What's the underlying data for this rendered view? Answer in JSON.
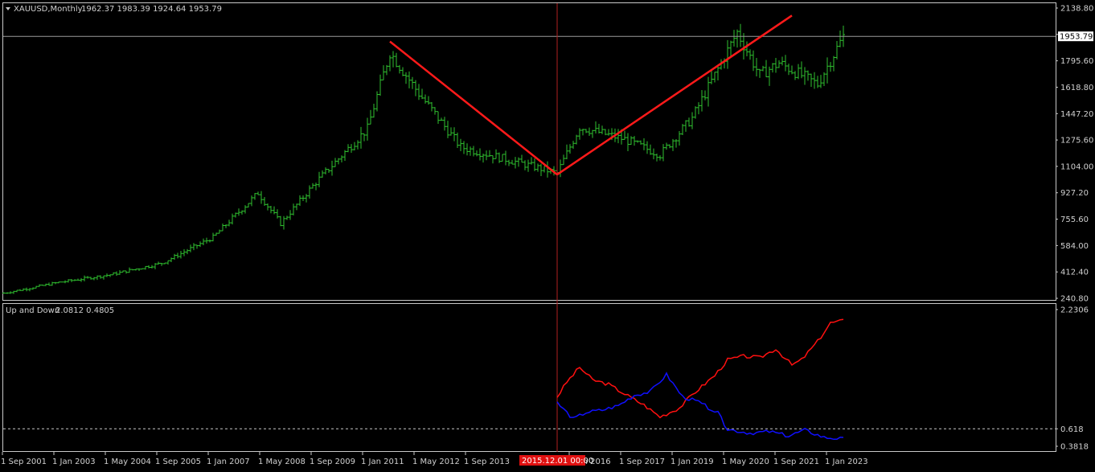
{
  "price_panel": {
    "header": {
      "symbol": "XAUUSD,Monthly",
      "ohlc": "1962.37 1983.39 1924.64 1953.79"
    },
    "y_ticks": [
      "2138.80",
      "1967.20",
      "1795.60",
      "1618.80",
      "1447.20",
      "1275.60",
      "1104.00",
      "927.20",
      "755.60",
      "584.00",
      "412.40",
      "240.80"
    ],
    "last_price_label": "1953.79",
    "colors": {
      "bar": "#2fc02f",
      "trendline": "#ff1a1a",
      "crosshair": "#b02020",
      "grid": "#9a9a9a",
      "label_bg": "#ffffff"
    }
  },
  "indicator_panel": {
    "header": {
      "name": "Up and Down",
      "values": "2.0812 0.4805"
    },
    "y_ticks": [
      "2.2306",
      "0.618",
      "0.3818"
    ],
    "colors": {
      "up_line": "#ff1010",
      "down_line": "#1010ff",
      "level_line": "#c8c8c8"
    }
  },
  "x_axis": {
    "tick_labels": [
      "1 Sep 2001",
      "1 Jan 2003",
      "1 May 2004",
      "1 Sep 2005",
      "1 Jan 2007",
      "1 May 2008",
      "1 Sep 2009",
      "1 Jan 2011",
      "1 May 2012",
      "1 Sep 2013",
      "1 Jan 2016",
      "1 Sep 2017",
      "1 Jan 2019",
      "1 May 2020",
      "1 Sep 2021",
      "1 Jan 2023"
    ],
    "crosshair_label": "2015.12.01 00:00"
  },
  "chart_data": [
    {
      "type": "line",
      "title": "XAUUSD,Monthly",
      "x_range": [
        "2001-08",
        "2023-06"
      ],
      "ylim": [
        240.8,
        2138.8
      ],
      "series": [
        {
          "name": "XAUUSD,Monthly",
          "x": [
            "2001-08",
            "2003-01",
            "2004-05",
            "2005-09",
            "2007-01",
            "2008-03",
            "2008-10",
            "2009-09",
            "2011-01",
            "2011-08",
            "2012-05",
            "2013-06",
            "2015-12",
            "2016-07",
            "2017-09",
            "2018-08",
            "2019-06",
            "2020-08",
            "2021-03",
            "2021-09",
            "2022-09",
            "2023-05"
          ],
          "values": [
            275,
            345,
            395,
            470,
            640,
            930,
            730,
            1000,
            1350,
            1850,
            1580,
            1230,
            1060,
            1360,
            1280,
            1180,
            1420,
            1980,
            1700,
            1780,
            1640,
            1953.79
          ]
        }
      ],
      "annotations": [
        {
          "type": "trendline",
          "x": [
            "2011-08",
            "2015-12"
          ],
          "y": [
            1920,
            1050
          ]
        },
        {
          "type": "trendline",
          "x": [
            "2015-12",
            "2022-01"
          ],
          "y": [
            1050,
            2090
          ]
        },
        {
          "type": "hline",
          "y": 1953.79
        }
      ]
    },
    {
      "type": "line",
      "title": "Up and Down",
      "ylim": [
        0.3818,
        2.2306
      ],
      "series": [
        {
          "name": "Up",
          "x": [
            "2015-12",
            "2016-03",
            "2016-07",
            "2016-11",
            "2017-04",
            "2017-09",
            "2018-03",
            "2018-08",
            "2019-02",
            "2019-06",
            "2020-01",
            "2020-05",
            "2020-10",
            "2021-03",
            "2021-08",
            "2022-01",
            "2022-04",
            "2022-09",
            "2023-01",
            "2023-05"
          ],
          "values": [
            1.05,
            1.25,
            1.45,
            1.28,
            1.22,
            1.09,
            0.94,
            0.78,
            0.9,
            1.08,
            1.34,
            1.55,
            1.6,
            1.58,
            1.7,
            1.48,
            1.55,
            1.8,
            2.05,
            2.08
          ]
        },
        {
          "name": "Down",
          "x": [
            "2015-12",
            "2016-05",
            "2016-09",
            "2017-02",
            "2017-07",
            "2017-12",
            "2018-05",
            "2018-10",
            "2019-03",
            "2019-08",
            "2020-02",
            "2020-05",
            "2020-12",
            "2021-06",
            "2021-12",
            "2022-05",
            "2022-11",
            "2023-05"
          ],
          "values": [
            0.97,
            0.75,
            0.84,
            0.87,
            0.93,
            1.07,
            1.12,
            1.35,
            1.05,
            0.98,
            0.83,
            0.61,
            0.56,
            0.58,
            0.52,
            0.6,
            0.5,
            0.48
          ]
        }
      ],
      "annotations": [
        {
          "type": "hline",
          "y": 0.618
        }
      ]
    }
  ]
}
